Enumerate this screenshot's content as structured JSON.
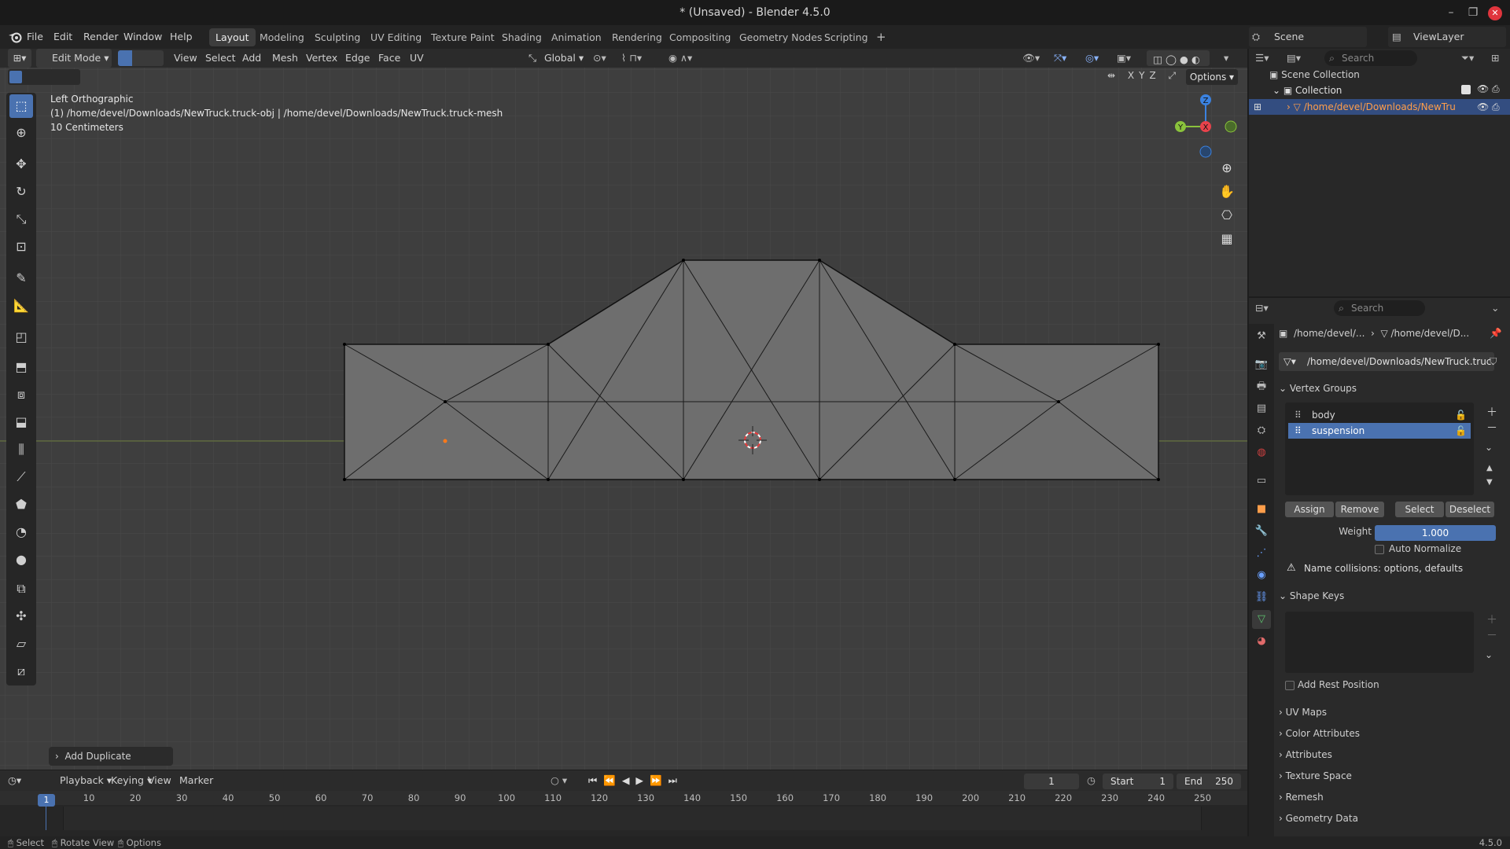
{
  "window": {
    "title": "* (Unsaved) - Blender 4.5.0",
    "min": "–",
    "max": "❐",
    "close": "✕"
  },
  "menus": [
    "File",
    "Edit",
    "Render",
    "Window",
    "Help"
  ],
  "workspaces": [
    "Layout",
    "Modeling",
    "Sculpting",
    "UV Editing",
    "Texture Paint",
    "Shading",
    "Animation",
    "Rendering",
    "Compositing",
    "Geometry Nodes",
    "Scripting"
  ],
  "workspace_add": "+",
  "scene": {
    "name": "Scene",
    "view_layer": "ViewLayer"
  },
  "header3d": {
    "mode": "Edit Mode",
    "menus": [
      "View",
      "Select",
      "Add",
      "Mesh",
      "Vertex",
      "Edge",
      "Face",
      "UV"
    ],
    "orientation": "Global",
    "options": "Options",
    "axes": [
      "X",
      "Y",
      "Z"
    ]
  },
  "viewport": {
    "view_name": "Left Orthographic",
    "object_info": "(1) /home/devel/Downloads/NewTruck.truck-obj | /home/devel/Downloads/NewTruck.truck-mesh",
    "scale": "10 Centimeters",
    "gizmo": {
      "z": "Z",
      "y": "Y",
      "x": "X"
    },
    "last_op": "Add Duplicate"
  },
  "outliner": {
    "search_placeholder": "Search",
    "scene_collection": "Scene Collection",
    "collection": "Collection",
    "object": "/home/devel/Downloads/NewTru"
  },
  "properties": {
    "search_placeholder": "Search",
    "breadcrumb1": "/home/devel/...",
    "breadcrumb2": "/home/devel/D...",
    "mesh_name": "/home/devel/Downloads/NewTruck.truc...",
    "vertex_groups": {
      "title": "Vertex Groups",
      "items": [
        "body",
        "suspension"
      ],
      "selected": "suspension"
    },
    "buttons": {
      "assign": "Assign",
      "remove": "Remove",
      "select": "Select",
      "deselect": "Deselect"
    },
    "weight_label": "Weight",
    "weight": "1.000",
    "auto_normalize": "Auto Normalize",
    "warning": "Name collisions: options, defaults",
    "shape_keys": "Shape Keys",
    "add_rest_position": "Add Rest Position",
    "panels": [
      "UV Maps",
      "Color Attributes",
      "Attributes",
      "Texture Space",
      "Remesh",
      "Geometry Data"
    ]
  },
  "timeline": {
    "menus": [
      "Playback",
      "Keying",
      "View",
      "Marker"
    ],
    "current_frame": "1",
    "start_label": "Start",
    "start": "1",
    "end_label": "End",
    "end": "250",
    "ruler": [
      "1",
      "10",
      "20",
      "30",
      "40",
      "50",
      "60",
      "70",
      "80",
      "90",
      "100",
      "110",
      "120",
      "130",
      "140",
      "150",
      "160",
      "170",
      "180",
      "190",
      "200",
      "210",
      "220",
      "230",
      "240",
      "250"
    ]
  },
  "statusbar": {
    "select": "Select",
    "rotate": "Rotate View",
    "options": "Options",
    "version": "4.5.0"
  },
  "colors": {
    "accent": "#4a72b0",
    "axis_x": "#e8424b",
    "axis_y": "#8ac23c",
    "axis_z": "#3b82e0"
  }
}
